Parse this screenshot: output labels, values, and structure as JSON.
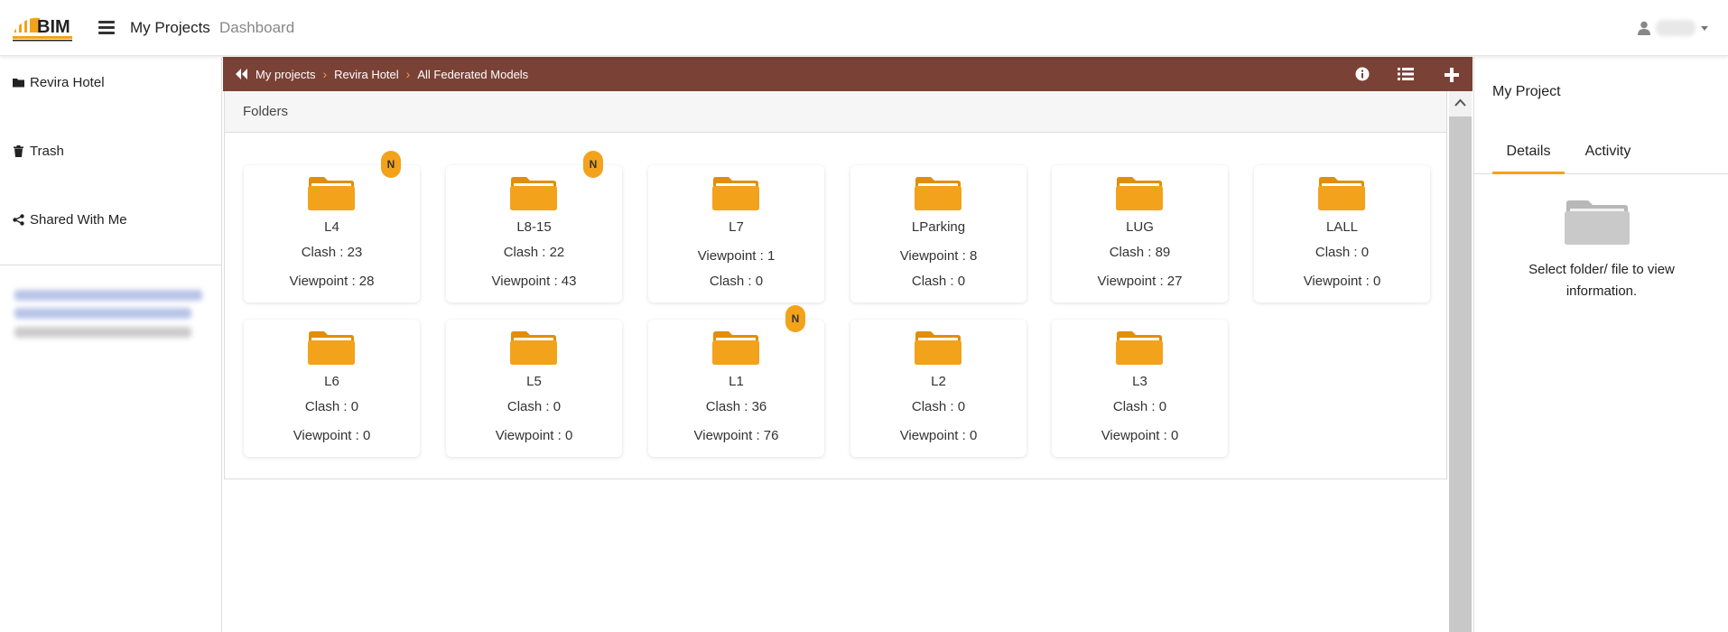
{
  "brand": {
    "logo_text": "BIM",
    "accent": "#f3a21b",
    "dark": "#222222"
  },
  "topnav": {
    "my_projects": "My Projects",
    "dashboard": "Dashboard"
  },
  "sidebar": {
    "items": [
      {
        "label": "Revira Hotel",
        "icon": "folder-icon"
      },
      {
        "label": "Trash",
        "icon": "trash-icon"
      },
      {
        "label": "Shared With Me",
        "icon": "share-icon"
      }
    ]
  },
  "breadcrumb": {
    "items": [
      "My projects",
      "Revira Hotel",
      "All Federated Models"
    ],
    "bar_color": "#7a4136",
    "separator": "›"
  },
  "panel": {
    "heading": "Folders"
  },
  "cards": [
    {
      "title": "L4",
      "line1": "Clash : 23",
      "line2": "Viewpoint : 28",
      "badge": "N"
    },
    {
      "title": "L8-15",
      "line1": "Clash : 22",
      "line2": "Viewpoint : 43",
      "badge": "N"
    },
    {
      "title": "L7",
      "line1": "Viewpoint : 1",
      "line2": "Clash : 0",
      "badge": ""
    },
    {
      "title": "LParking",
      "line1": "Viewpoint : 8",
      "line2": "Clash : 0",
      "badge": ""
    },
    {
      "title": "LUG",
      "line1": "Clash : 89",
      "line2": "Viewpoint : 27",
      "badge": ""
    },
    {
      "title": "LALL",
      "line1": "Clash : 0",
      "line2": "Viewpoint : 0",
      "badge": ""
    },
    {
      "title": "L6",
      "line1": "Clash : 0",
      "line2": "Viewpoint : 0",
      "badge": ""
    },
    {
      "title": "L5",
      "line1": "Clash : 0",
      "line2": "Viewpoint : 0",
      "badge": ""
    },
    {
      "title": "L1",
      "line1": "Clash : 36",
      "line2": "Viewpoint : 76",
      "badge": "N"
    },
    {
      "title": "L2",
      "line1": "Clash : 0",
      "line2": "Viewpoint : 0",
      "badge": ""
    },
    {
      "title": "L3",
      "line1": "Clash : 0",
      "line2": "Viewpoint : 0",
      "badge": ""
    }
  ],
  "rightpanel": {
    "title": "My Project",
    "tabs": [
      "Details",
      "Activity"
    ],
    "active_tab": "Details",
    "message": "Select folder/ file to view information."
  }
}
